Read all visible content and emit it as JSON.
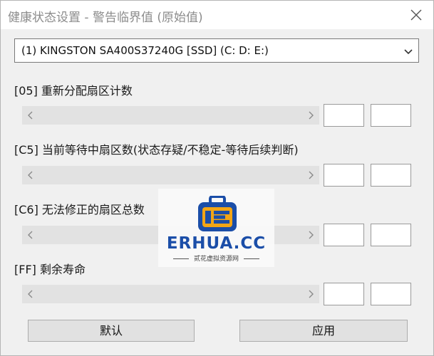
{
  "window": {
    "title": "健康状态设置 - 警告临界值 (原始值)"
  },
  "drive_select": {
    "value": "(1) KINGSTON SA400S37240G [SSD] (C: D: E:)"
  },
  "sections": [
    {
      "label": "[05] 重新分配扇区计数",
      "value_a": "",
      "value_b": ""
    },
    {
      "label": "[C5] 当前等待中扇区数(状态存疑/不稳定-等待后续判断)",
      "value_a": "",
      "value_b": ""
    },
    {
      "label": "[C6] 无法修正的扇区总数",
      "value_a": "",
      "value_b": ""
    },
    {
      "label": "[FF] 剩余寿命",
      "value_a": "",
      "value_b": ""
    }
  ],
  "buttons": {
    "default_label": "默认",
    "apply_label": "应用"
  },
  "watermark": {
    "brand": "ERHUA.CC",
    "tagline": "贰花虚拟资源网"
  },
  "colors": {
    "title_text": "#8c8c8c",
    "window_bg": "#f0f0f0",
    "watermark_blue": "#1b4ea8",
    "watermark_orange": "#f2a516"
  },
  "icons": {
    "close": "close-icon",
    "dropdown": "chevron-down-icon",
    "scroll_left": "chevron-left-icon",
    "scroll_right": "chevron-right-icon",
    "watermark": "briefcase-icon"
  }
}
